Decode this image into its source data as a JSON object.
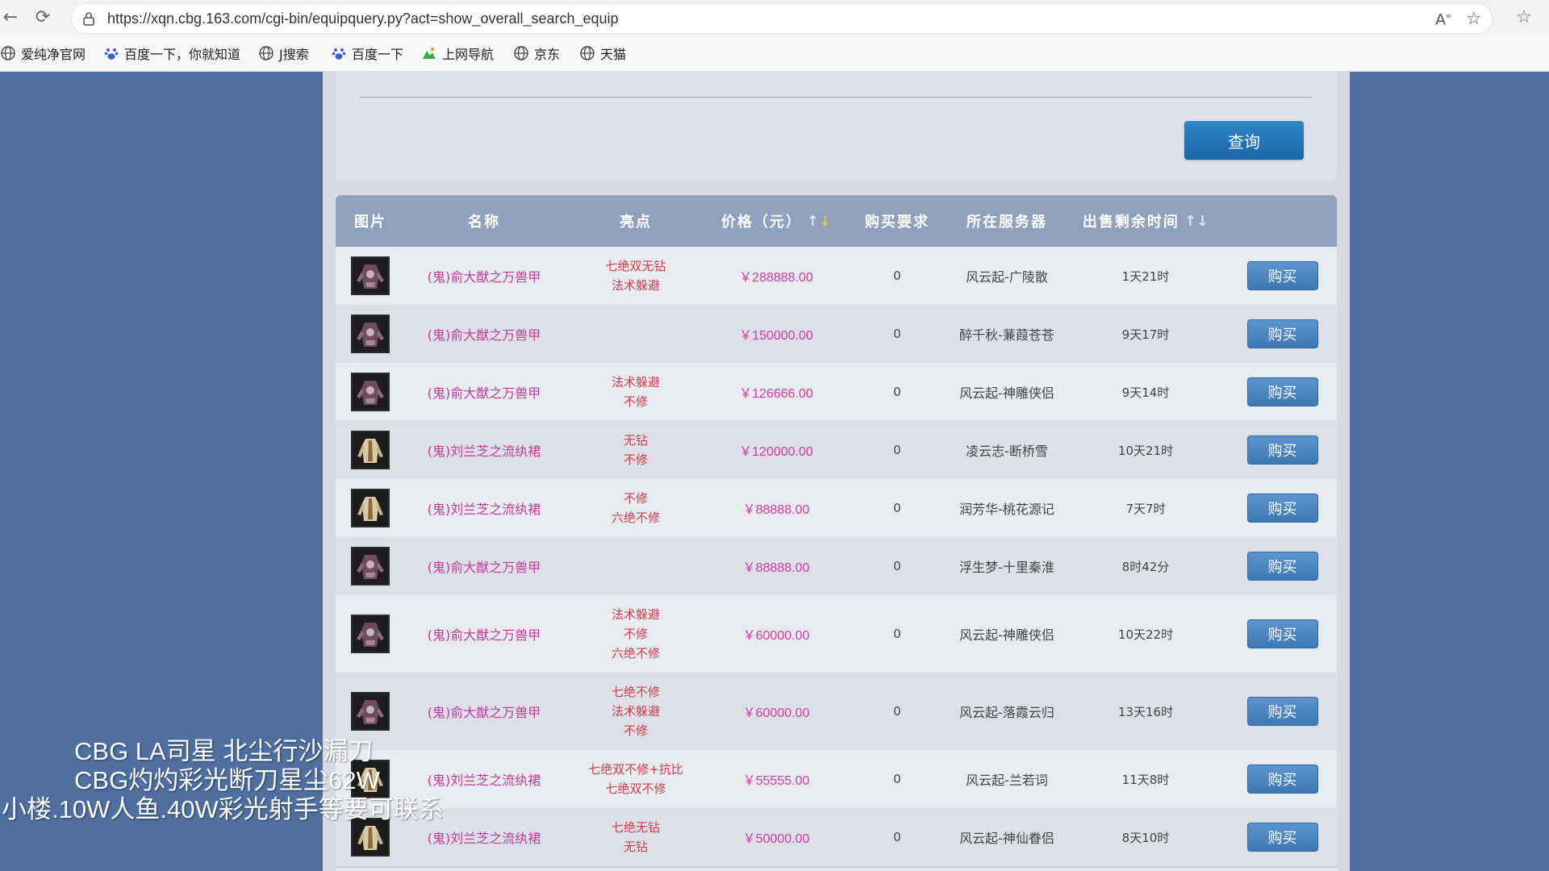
{
  "browser": {
    "url": "https://xqn.cbg.163.com/cgi-bin/equipquery.py?act=show_overall_search_equip",
    "bookmarks": [
      {
        "label": "爱纯净官网",
        "icon": "globe-icon"
      },
      {
        "label": "百度一下，你就知道",
        "icon": "paw-icon"
      },
      {
        "label": "J搜索",
        "icon": "globe-icon"
      },
      {
        "label": "百度一下",
        "icon": "paw-icon"
      },
      {
        "label": "上网导航",
        "icon": "nav-icon"
      },
      {
        "label": "京东",
        "icon": "globe-icon"
      },
      {
        "label": "天猫",
        "icon": "globe-icon"
      }
    ]
  },
  "search": {
    "query_label": "查询"
  },
  "table": {
    "headers": {
      "image": "图片",
      "name": "名称",
      "highlight": "亮点",
      "price": "价格（元）",
      "requirement": "购买要求",
      "server": "所在服务器",
      "time_left": "出售剩余时间"
    },
    "sort_up": "↑",
    "sort_down": "↓",
    "buy_label": "购买",
    "rows": [
      {
        "name": "(鬼)俞大猷之万兽甲",
        "highlights": [
          "七绝双无钻",
          "法术躲避"
        ],
        "price": "￥288888.00",
        "req": "0",
        "server": "风云起-广陵散",
        "time": "1天21时",
        "thumb": "armor"
      },
      {
        "name": "(鬼)俞大猷之万兽甲",
        "highlights": [],
        "price": "￥150000.00",
        "req": "0",
        "server": "醉千秋-蒹葭苍苍",
        "time": "9天17时",
        "thumb": "armor"
      },
      {
        "name": "(鬼)俞大猷之万兽甲",
        "highlights": [
          "法术躲避",
          "不修"
        ],
        "price": "￥126666.00",
        "req": "0",
        "server": "风云起-神雕侠侣",
        "time": "9天14时",
        "thumb": "armor"
      },
      {
        "name": "(鬼)刘兰芝之流纨裙",
        "highlights": [
          "无钻",
          "不修"
        ],
        "price": "￥120000.00",
        "req": "0",
        "server": "凌云志-断桥雪",
        "time": "10天21时",
        "thumb": "robe"
      },
      {
        "name": "(鬼)刘兰芝之流纨裙",
        "highlights": [
          "不修",
          "六绝不修"
        ],
        "price": "￥88888.00",
        "req": "0",
        "server": "润芳华-桃花源记",
        "time": "7天7时",
        "thumb": "robe"
      },
      {
        "name": "(鬼)俞大猷之万兽甲",
        "highlights": [],
        "price": "￥88888.00",
        "req": "0",
        "server": "浮生梦-十里秦淮",
        "time": "8时42分",
        "thumb": "armor"
      },
      {
        "name": "(鬼)俞大猷之万兽甲",
        "highlights": [
          "法术躲避",
          "不修",
          "六绝不修"
        ],
        "price": "￥60000.00",
        "req": "0",
        "server": "风云起-神雕侠侣",
        "time": "10天22时",
        "thumb": "armor"
      },
      {
        "name": "(鬼)俞大猷之万兽甲",
        "highlights": [
          "七绝不修",
          "法术躲避",
          "不修"
        ],
        "price": "￥60000.00",
        "req": "0",
        "server": "风云起-落霞云归",
        "time": "13天16时",
        "thumb": "armor"
      },
      {
        "name": "(鬼)刘兰芝之流纨裙",
        "highlights": [
          "七绝双不修+抗比",
          "七绝双不修"
        ],
        "price": "￥55555.00",
        "req": "0",
        "server": "风云起-兰若词",
        "time": "11天8时",
        "thumb": "robe"
      },
      {
        "name": "(鬼)刘兰芝之流纨裙",
        "highlights": [
          "七绝无钻",
          "无钻"
        ],
        "price": "￥50000.00",
        "req": "0",
        "server": "风云起-神仙眷侣",
        "time": "8天10时",
        "thumb": "robe"
      }
    ]
  },
  "overlay": {
    "lines": [
      "CBG LA司星 北尘行沙漏刀",
      "CBG灼灼彩光断刀星尘62W",
      "小楼.10W人鱼.40W彩光射手等要可联系"
    ]
  },
  "colors": {
    "page_bg": "#4e6fa0",
    "header_bg": "#8fa1bd",
    "name": "#c0399e",
    "highlight": "#d23c46",
    "price": "#cf3aa8",
    "button": "#3f78b6"
  }
}
